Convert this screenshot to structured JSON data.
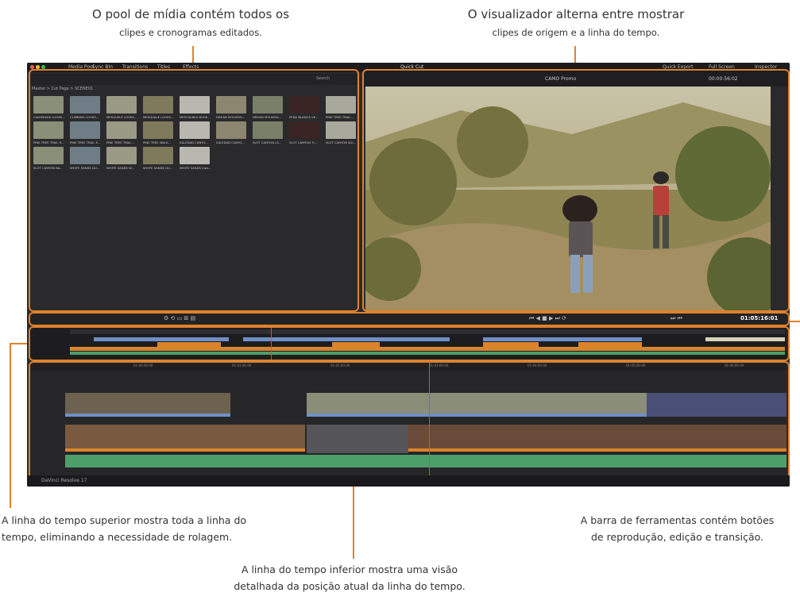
{
  "annotations": {
    "media_pool": {
      "line1": "O pool de mídia contém todos os",
      "line2": "clipes e cronogramas editados."
    },
    "viewer": {
      "line1": "O visualizador alterna entre mostrar",
      "line2": "clipes de origem e a linha do tempo."
    },
    "upper_timeline": {
      "line1": "A linha do tempo superior mostra toda a linha do",
      "line2": "tempo, eliminando a necessidade de rolagem."
    },
    "toolbar": {
      "line1": "A barra de ferramentas contém botões",
      "line2": "de reprodução, edição e transição."
    },
    "lower_timeline": {
      "line1": "A linha do tempo inferior mostra uma visão",
      "line2": "detalhada da posição atual da linha do tempo."
    }
  },
  "app": {
    "tabs": [
      "Media Pool",
      "Sync Bin",
      "Transitions",
      "Titles",
      "Effects"
    ],
    "media_path": "Master > Cut Page > SCENE01",
    "search_placeholder": "Search",
    "viewer_title": "Quick Cut",
    "viewer_source": "CAMO Promo",
    "viewer_timecode": "00:00:56:02",
    "right_tabs": [
      "Quick Export",
      "Full Screen",
      "Inspector"
    ],
    "timecode": "01:05:16:01",
    "resolve_label": "DaVinci Resolve 17",
    "thumb_labels": [
      "CANYNHIKE-LOOKS...",
      "CLIMBING LOOKS...",
      "MESQUELE LOOKS...",
      "MESQUALE LOOKS...",
      "MESCALNEA DUSK...",
      "DREAM MOUNTAI...",
      "DREAM MOUNTAI...",
      "PENA BLANCA VE...",
      "PINE TREE TRAIL...",
      "PINE TREE TRAIL R...",
      "PINE TREE TRAIL E...",
      "PINE TREE TRAIL...",
      "PINE TREE WALK...",
      "SALEDAD CANYO...",
      "SALEDAD CANYO...",
      "SLOT CANYON LO...",
      "SLOT CANYON TI...",
      "SLOT CANYON W2...",
      "SLOT CANYON BA...",
      "WHITE SANDS DU...",
      "WHITE SANDS W...",
      "WHITE SANDS DU...",
      "WHITE SANDS mov..."
    ],
    "ruler_marks": [
      "01:00:00:00",
      "01:01:00:00",
      "01:02:00:00",
      "01:03:00:00",
      "01:04:00:00",
      "01:05:00:00",
      "01:06:00:00",
      "01:07:00:00"
    ]
  },
  "colors": {
    "accent": "#e0812c",
    "audio_track": "#4d9f6a",
    "video_blue": "#6f8fc5",
    "video_orange": "#d9842c"
  }
}
